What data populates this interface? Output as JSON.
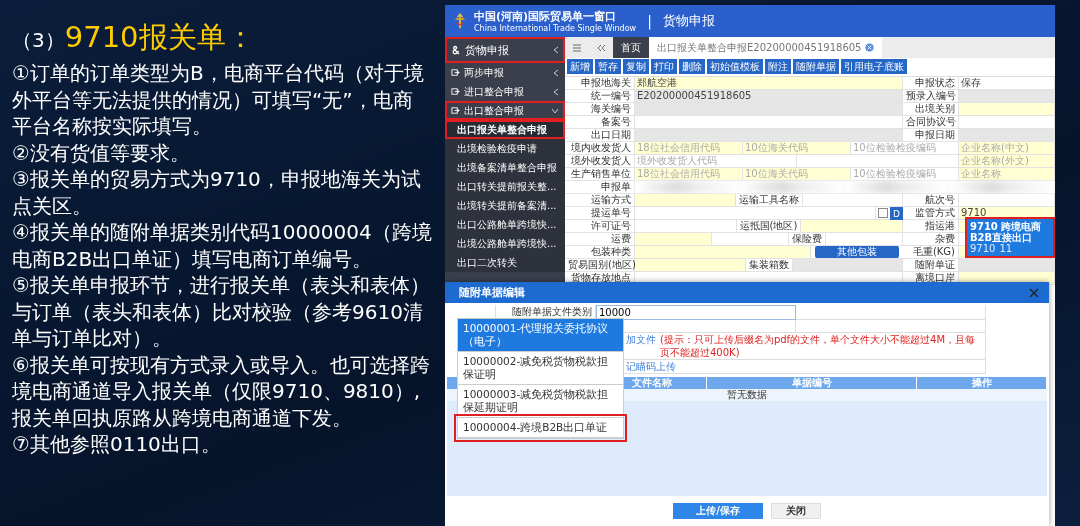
{
  "slide": {
    "title_prefix": "（3）",
    "title": "9710报关单：",
    "points": [
      "①订单的订单类型为B，电商平台代码（对于境外平台等无法提供的情况）可填写“无”，电商平台名称按实际填写。",
      "②没有货值等要求。",
      "③报关单的贸易方式为9710，申报地海关为试点关区。",
      "④报关单的随附单据类别代码10000004（跨境电商B2B出口单证）填写电商订单编号。",
      "⑤报关单申报环节，进行报关单（表头和表体）与订单（表头和表体）比对校验（参考9610清单与订单比对）。",
      "⑥报关单可按现有方式录入或导入。也可选择跨境电商通道导入报关单（仅限9710、9810）,报关单回执原路从跨境电商通道下发。",
      "⑦其他参照0110出口。"
    ]
  },
  "header": {
    "title": "中国(河南)国际贸易单一窗口",
    "subtitle": "China International Trade Single Window",
    "separator": "|",
    "module": "货物申报"
  },
  "sidebar": {
    "title": {
      "label": "货物申报",
      "highlighted": true
    },
    "items": [
      {
        "label": "两步申报",
        "expanded": false,
        "highlighted": false
      },
      {
        "label": "进口整合申报",
        "expanded": false,
        "highlighted": false
      },
      {
        "label": "出口整合申报",
        "expanded": true,
        "highlighted": true,
        "children": [
          {
            "label": "出口报关单整合申报",
            "selected": true,
            "highlighted": true
          },
          {
            "label": "出境检验检疫申请",
            "selected": false,
            "highlighted": false
          },
          {
            "label": "出境备案清单整合申报",
            "selected": false,
            "highlighted": false
          },
          {
            "label": "出口转关提前报关整...",
            "selected": false,
            "highlighted": false
          },
          {
            "label": "出境转关提前备案清...",
            "selected": false,
            "highlighted": false
          },
          {
            "label": "出口公路舱单跨境快...",
            "selected": false,
            "highlighted": false
          },
          {
            "label": "出境公路舱单跨境快...",
            "selected": false,
            "highlighted": false
          },
          {
            "label": "出口二次转关",
            "selected": false,
            "highlighted": false
          }
        ]
      }
    ]
  },
  "tabs": [
    {
      "label": "首页",
      "kind": "home",
      "selected": false,
      "closable": false
    },
    {
      "label": "出口报关单整合申报E20200000451918605",
      "kind": "page",
      "selected": true,
      "closable": true
    }
  ],
  "toolbar": [
    "新增",
    "暂存",
    "复制",
    "打印",
    "删除",
    "初始值模板",
    "附注",
    "随附单据",
    "引用电子底账"
  ],
  "form": [
    [
      {
        "kind": "label",
        "text": "申报地海关"
      },
      {
        "kind": "field",
        "value": "郑航空港",
        "required": true,
        "disabled": false
      },
      {
        "kind": "label",
        "text": "申报状态"
      },
      {
        "kind": "field",
        "value": "保存",
        "required": false,
        "disabled": false
      }
    ],
    [
      {
        "kind": "label",
        "text": "统一编号"
      },
      {
        "kind": "field",
        "value": "E20200000451918605",
        "disabled": true
      },
      {
        "kind": "label",
        "text": "预录入编号"
      },
      {
        "kind": "field",
        "disabled": true
      }
    ],
    [
      {
        "kind": "label",
        "text": "海关编号"
      },
      {
        "kind": "field",
        "disabled": true
      },
      {
        "kind": "label",
        "text": "出境关别"
      },
      {
        "kind": "field",
        "required": true,
        "disabled": false
      }
    ],
    [
      {
        "kind": "label",
        "text": "备案号"
      },
      {
        "kind": "field",
        "required": false,
        "disabled": false
      },
      {
        "kind": "label",
        "text": "合同协议号"
      },
      {
        "kind": "field",
        "required": false,
        "disabled": false
      }
    ],
    [
      {
        "kind": "label",
        "text": "出口日期"
      },
      {
        "kind": "field",
        "disabled": true
      },
      {
        "kind": "label",
        "text": "申报日期"
      },
      {
        "kind": "field",
        "disabled": true
      }
    ],
    [
      {
        "kind": "label",
        "text": "境内收发货人"
      },
      {
        "kind": "field",
        "placeholder": "18位社会信用代码",
        "required": true,
        "disabled": false
      },
      {
        "kind": "field",
        "placeholder": "10位海关代码",
        "required": true,
        "disabled": false
      },
      {
        "kind": "field",
        "placeholder": "10位检验检疫编码",
        "required": false,
        "disabled": false
      },
      {
        "kind": "field",
        "placeholder": "企业名称(中文)",
        "required": true,
        "disabled": false
      }
    ],
    [
      {
        "kind": "label",
        "text": "境外收发货人"
      },
      {
        "kind": "field",
        "placeholder": "境外收发货人代码",
        "required": false,
        "disabled": false
      },
      {
        "kind": "field",
        "required": false,
        "disabled": false
      },
      {
        "kind": "field",
        "placeholder": "企业名称(外文)",
        "required": true,
        "disabled": false
      }
    ],
    [
      {
        "kind": "label",
        "text": "生产销售单位"
      },
      {
        "kind": "field",
        "placeholder": "18位社会信用代码",
        "required": true,
        "disabled": false
      },
      {
        "kind": "field",
        "placeholder": "10位海关代码",
        "required": true,
        "disabled": false
      },
      {
        "kind": "field",
        "placeholder": "10位检验检疫编码",
        "required": false,
        "disabled": false
      },
      {
        "kind": "field",
        "placeholder": "企业名称",
        "required": true,
        "disabled": false
      }
    ],
    [
      {
        "kind": "label",
        "text": "申报单"
      },
      {
        "kind": "blur"
      },
      {
        "kind": "blur"
      },
      {
        "kind": "blur"
      },
      {
        "kind": "blur"
      }
    ],
    [
      {
        "kind": "label",
        "text": "运输方式"
      },
      {
        "kind": "field",
        "required": true,
        "disabled": false
      },
      {
        "kind": "label",
        "text": "运输工具名称"
      },
      {
        "kind": "field",
        "required": false,
        "disabled": false
      },
      {
        "kind": "label",
        "text": "航次号"
      },
      {
        "kind": "field",
        "required": false,
        "disabled": false
      }
    ],
    [
      {
        "kind": "label",
        "text": "提运单号"
      },
      {
        "kind": "field",
        "required": false,
        "disabled": false
      },
      {
        "kind": "checkbox",
        "checked": false
      },
      {
        "kind": "button",
        "text": "D"
      },
      {
        "kind": "label",
        "text": "监管方式"
      },
      {
        "kind": "field",
        "value": "9710",
        "required": true,
        "disabled": false,
        "suggestions": {
          "highlighted": true,
          "options": [
            {
              "name": "9710 跨境电商B2B直接出口",
              "code": "9710",
              "column_3": "11"
            }
          ]
        }
      }
    ],
    [
      {
        "kind": "label",
        "text": "许可证号"
      },
      {
        "kind": "field",
        "required": false,
        "disabled": false
      },
      {
        "kind": "label",
        "text": "运抵国(地区)"
      },
      {
        "kind": "field",
        "required": true,
        "disabled": false
      },
      {
        "kind": "label",
        "text": "指运港"
      },
      {
        "kind": "field",
        "required": true,
        "disabled": false
      }
    ],
    [
      {
        "kind": "label",
        "text": "运费"
      },
      {
        "kind": "field",
        "required": true,
        "disabled": false
      },
      {
        "kind": "field",
        "required": false,
        "disabled": false
      },
      {
        "kind": "label",
        "text": "保险费"
      },
      {
        "kind": "field",
        "required": false,
        "disabled": false
      },
      {
        "kind": "label",
        "text": "杂费"
      },
      {
        "kind": "field",
        "required": false,
        "disabled": false
      }
    ],
    [
      {
        "kind": "label",
        "text": "包装种类"
      },
      {
        "kind": "field",
        "required": true,
        "disabled": false
      },
      {
        "kind": "button",
        "text": "其他包装"
      },
      {
        "kind": "label",
        "text": "毛重(KG)"
      },
      {
        "kind": "field",
        "required": true,
        "disabled": false
      }
    ],
    [
      {
        "kind": "label",
        "text": "贸易国别(地区)"
      },
      {
        "kind": "field",
        "required": true,
        "disabled": false
      },
      {
        "kind": "label",
        "text": "集装箱数"
      },
      {
        "kind": "field",
        "disabled": true
      },
      {
        "kind": "label",
        "text": "随附单证"
      },
      {
        "kind": "field",
        "disabled": true
      }
    ],
    [
      {
        "kind": "label",
        "text": "货物存放地点"
      },
      {
        "kind": "field",
        "required": false,
        "disabled": false
      },
      {
        "kind": "label",
        "text": "离境口岸"
      },
      {
        "kind": "field",
        "required": true,
        "disabled": false
      }
    ]
  ],
  "modal": {
    "title": "随附单据编辑",
    "type_label": "随附单据文件类别",
    "type_value": "10000",
    "add_file": "加文件",
    "hint": "(提示：只可上传后缀名为pdf的文件，单个文件大小不能超过4M，且每页不能超过400K)",
    "scan_upload": "记瞄码上传",
    "options": [
      {
        "text": "10000001-代理报关委托协议（电子）",
        "selected": true,
        "highlighted": false
      },
      {
        "text": "10000002-减免税货物税款担保证明",
        "selected": false,
        "highlighted": false
      },
      {
        "text": "10000003-减免税货物税款担保延期证明",
        "selected": false,
        "highlighted": false
      },
      {
        "text": "10000004-跨境B2B出口单证",
        "selected": false,
        "highlighted": true
      }
    ],
    "columns": [
      "文件名称",
      "单据编号",
      "操作"
    ],
    "empty": "暂无数据",
    "buttons": [
      {
        "label": "上传/保存",
        "kind": "primary"
      },
      {
        "label": "关闭",
        "kind": "default"
      }
    ]
  }
}
